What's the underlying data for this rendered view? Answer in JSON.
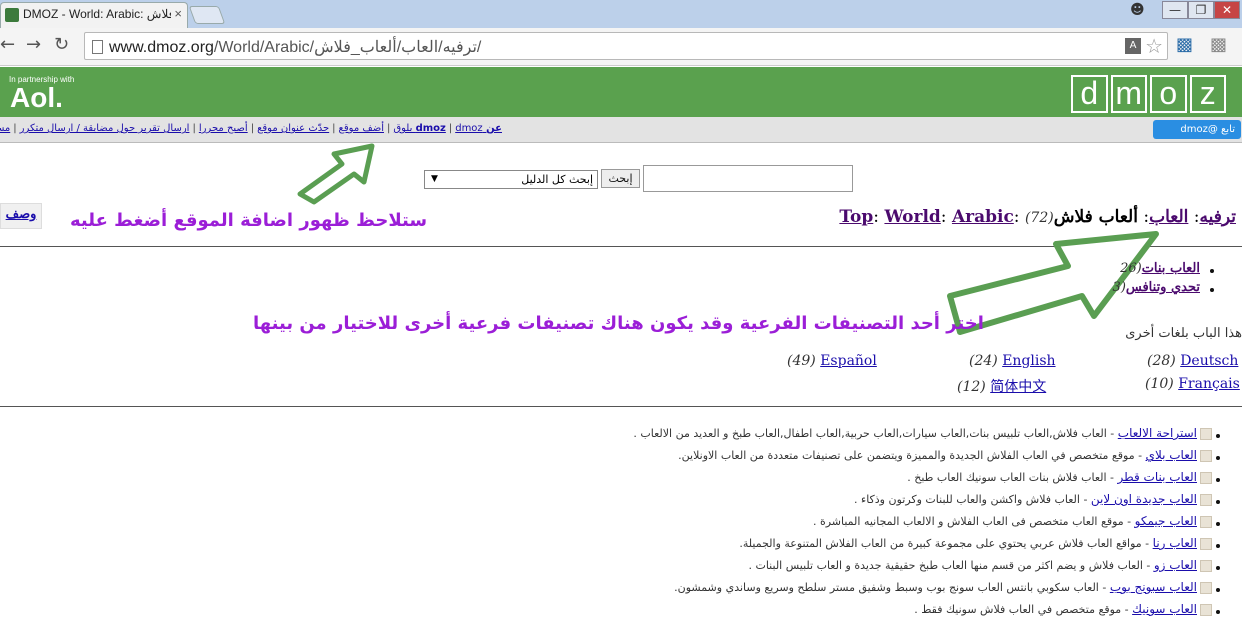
{
  "browser": {
    "tab_title": "DMOZ - World: Arabic: ألعاب فلاش",
    "tab_close": "×",
    "url_host": "www.dmoz.org",
    "url_path": "/World/Arabic/ترفيه/العاب/ألعاب_فلاش/",
    "back": "←",
    "forward": "→",
    "reload": "↻",
    "window_min": "—",
    "window_max": "❐",
    "window_close": "✕",
    "star": "☆",
    "translate": "A"
  },
  "banner": {
    "partner_text": "In partnership with",
    "aol": "Aol.",
    "dmoz_letters": [
      "d",
      "m",
      "o",
      "z"
    ],
    "color": "#5aa14e"
  },
  "linkbar": {
    "about_dmoz": "عن dmoz",
    "dmoz_blog": "dmoz بلوق",
    "add_site": "أضف موقع",
    "update_url": "حدّث عنوان موقع",
    "become_editor": "أصبح محررا",
    "report_abuse": "ارسال تقرير حول مضايقة / ارسال متكرر",
    "help": "مساعدة",
    "twitter": "تابع @dmoz"
  },
  "search": {
    "input_value": "",
    "button_label": "إبحث",
    "select_value": "إبحث كل الدليل"
  },
  "breadcrumb": {
    "top": "Top",
    "world": "World",
    "arabic": "Arabic",
    "entertainment": "ترفيه",
    "games": "العاب",
    "current": "ألعاب فلاش",
    "count": "(72)",
    "desc_button": "وصف"
  },
  "annotations": {
    "add_site_note": "ستلاحظ ظهور اضافة الموقع أضغط عليه",
    "subcategory_note": "اختر أحد التصنيفات الفرعية وقد يكون هناك تصنيفات فرعية أخرى للاختيار من بينها",
    "color": "#9b1ed7",
    "arrow_color": "#5a9e52"
  },
  "subcategories": [
    {
      "label": "العاب بنات",
      "count": "(26"
    },
    {
      "label": "تحدي وتنافس",
      "count": "(3"
    }
  ],
  "other_languages": {
    "heading": "هذا الباب بلغات أخرى",
    "items": [
      {
        "label": "Deutsch",
        "count": "(28)"
      },
      {
        "label": "English",
        "count": "(24)"
      },
      {
        "label": "Español",
        "count": "(49)"
      },
      {
        "label": "Français",
        "count": "(10)"
      },
      {
        "label": "简体中文",
        "count": "(12)"
      }
    ]
  },
  "sites": [
    {
      "title": "استراحة الالعاب",
      "desc": " - العاب فلاش,العاب تلبيس بنات,العاب سيارات,العاب حربية,العاب اطفال,العاب طبخ و العديد من الالعاب ."
    },
    {
      "title": "العاب بلاي",
      "desc": " - موقع متخصص في العاب الفلاش الجديدة والمميزة ويتضمن على تصنيفات متعددة من العاب الاونلاين."
    },
    {
      "title": "العاب بنات قطر",
      "desc": " - العاب فلاش بنات العاب سونيك العاب طبخ ."
    },
    {
      "title": "العاب جديدة اون لاين",
      "desc": " - العاب فلاش واكشن والعاب للبنات وكرتون وذكاء ."
    },
    {
      "title": "العاب جيمكو",
      "desc": " - موقع العاب متخصص فى العاب الفلاش و الالعاب المجانيه المباشرة ."
    },
    {
      "title": "العاب رنا",
      "desc": " - مواقع العاب فلاش عربي يحتوي على مجموعة كبيرة من العاب الفلاش المتنوعة والجميلة."
    },
    {
      "title": "العاب زو",
      "desc": " - العاب فلاش و يضم اكثر من قسم منها العاب طبخ حقيقية جديدة و العاب تلبيس البنات ."
    },
    {
      "title": "العاب سبونج بوب",
      "desc": " - العاب سكوبي بانتس العاب سونج بوب وسبط وشفيق مستر سلطح وسريع وساندي وشمشون."
    },
    {
      "title": "العاب سونيك",
      "desc": " - موقع متخصص في العاب فلاش سونيك فقط ."
    }
  ]
}
